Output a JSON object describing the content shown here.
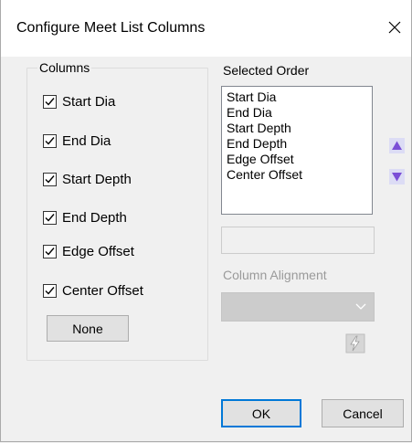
{
  "window": {
    "title": "Configure Meet List Columns",
    "close_icon": "close-icon"
  },
  "columns_group": {
    "legend": "Columns",
    "items": [
      {
        "label": "Start Dia",
        "checked": true
      },
      {
        "label": "End Dia",
        "checked": true
      },
      {
        "label": "Start Depth",
        "checked": true
      },
      {
        "label": "End Depth",
        "checked": true
      },
      {
        "label": "Edge Offset",
        "checked": true
      },
      {
        "label": "Center Offset",
        "checked": true
      }
    ],
    "none_button": "None"
  },
  "selected_order": {
    "label": "Selected Order",
    "items": [
      "Start Dia",
      "End Dia",
      "Start Depth",
      "End Depth",
      "Edge Offset",
      "Center Offset"
    ],
    "move_up_icon": "triangle-up-icon",
    "move_down_icon": "triangle-down-icon",
    "arrow_color": "#7b4fd6"
  },
  "alignment": {
    "label": "Column Alignment",
    "value": "",
    "dropdown_icon": "chevron-down-icon",
    "apply_icon": "lightning-icon"
  },
  "footer": {
    "ok": "OK",
    "cancel": "Cancel"
  }
}
